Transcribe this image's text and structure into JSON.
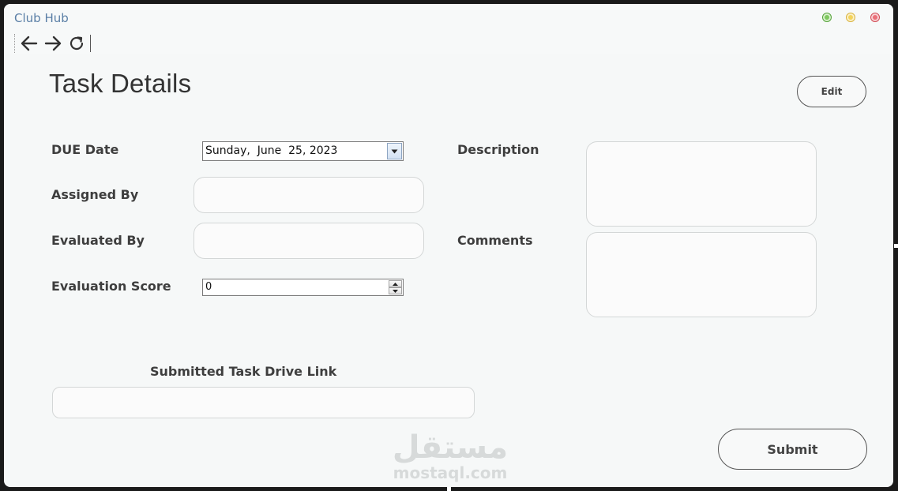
{
  "window": {
    "app_title": "Club Hub"
  },
  "page": {
    "title": "Task Details",
    "edit_label": "Edit",
    "submit_label": "Submit"
  },
  "form": {
    "due_date_label": "DUE Date",
    "due_date_value": "Sunday,  June  25, 2023",
    "assigned_by_label": "Assigned By",
    "assigned_by_value": "",
    "evaluated_by_label": "Evaluated By",
    "evaluated_by_value": "",
    "evaluation_score_label": "Evaluation Score",
    "evaluation_score_value": "0",
    "description_label": "Description",
    "description_value": "",
    "comments_label": "Comments",
    "comments_value": "",
    "drive_link_label": "Submitted Task Drive Link",
    "drive_link_value": ""
  },
  "watermark": {
    "arabic": "مستقل",
    "latin": "mostaql.com"
  },
  "icons": {
    "back": "arrow-left-icon",
    "forward": "arrow-right-icon",
    "refresh": "refresh-icon",
    "dropdown": "chevron-down-icon",
    "step_up": "triangle-up-icon",
    "step_down": "triangle-down-icon"
  },
  "colors": {
    "window_bg": "#f6f8f8",
    "app_title": "#5a7fa6",
    "text": "#3e3e3e",
    "button_border": "#555555"
  }
}
